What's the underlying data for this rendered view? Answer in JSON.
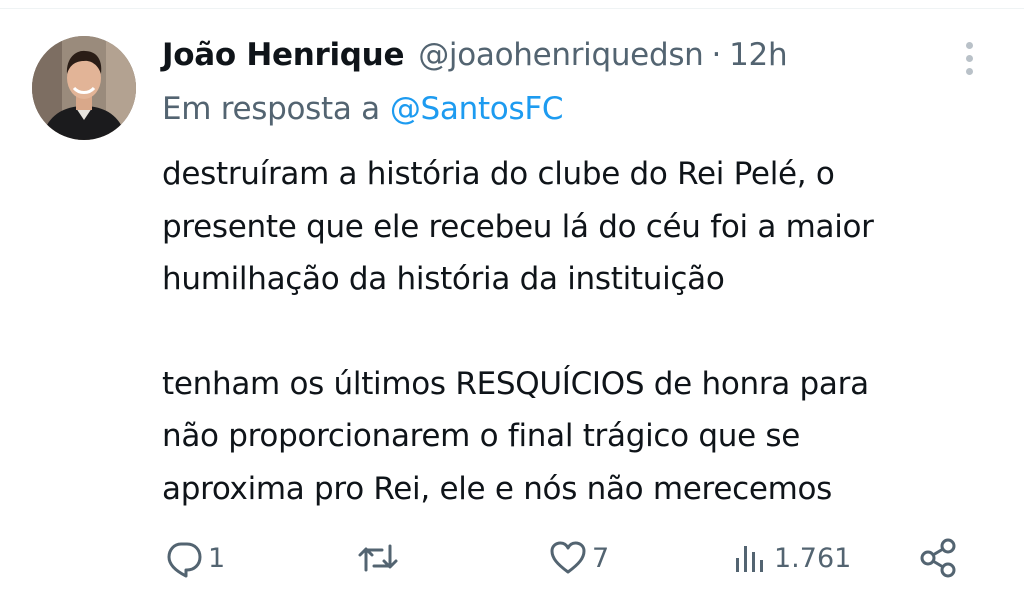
{
  "author": {
    "display_name": "João Henrique",
    "handle": "@joaohenriquedsn",
    "separator": "·",
    "time": "12h"
  },
  "reply": {
    "prefix": "Em resposta a",
    "target": "@SantosFC"
  },
  "tweet": {
    "paragraphs": [
      [
        "destruíram a história do clube do Rei Pelé, o",
        "presente que ele recebeu lá do céu foi a maior",
        "humilhação da história da instituição"
      ],
      [
        "tenham os últimos RESQUÍCIOS de honra para",
        "não proporcionarem o final trágico que se",
        "aproxima pro Rei, ele e nós não merecemos"
      ]
    ]
  },
  "actions": {
    "reply_count": "1",
    "retweet_count": "",
    "like_count": "7",
    "views_count": "1.761"
  },
  "icons": {
    "more": "more-vertical-icon",
    "reply": "comment-icon",
    "retweet": "retweet-icon",
    "like": "heart-icon",
    "views": "analytics-icon",
    "share": "share-icon"
  },
  "colors": {
    "text": "#0f1419",
    "secondary": "#536471",
    "link": "#1d9bf0"
  }
}
